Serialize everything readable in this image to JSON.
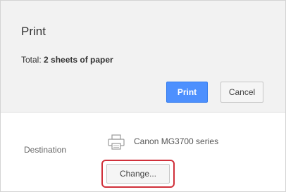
{
  "dialog": {
    "title": "Print",
    "total_prefix": "Total: ",
    "total_value": "2 sheets of paper"
  },
  "actions": {
    "print_label": "Print",
    "cancel_label": "Cancel"
  },
  "destination": {
    "label": "Destination",
    "printer_name": "Canon MG3700 series",
    "printer_icon": "printer-icon",
    "change_label": "Change..."
  },
  "colors": {
    "primary_button": "#4d90fe",
    "highlight": "#d0303a",
    "header_background": "#f2f2f2"
  }
}
